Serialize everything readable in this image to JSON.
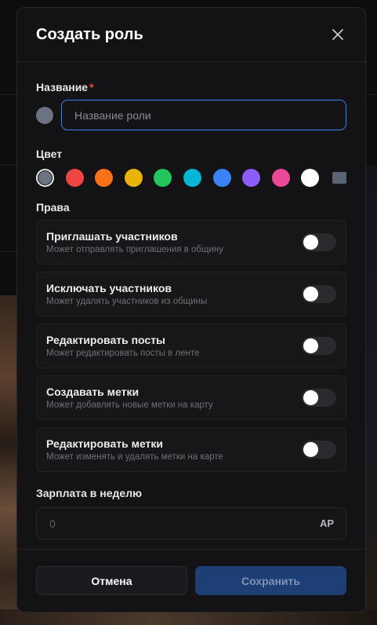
{
  "modal": {
    "title": "Создать роль",
    "close_icon": "close-icon"
  },
  "name_section": {
    "label": "Название",
    "required_mark": "*",
    "placeholder": "Название роли",
    "swatch_color": "#6b7280"
  },
  "color_section": {
    "label": "Цвет",
    "colors": [
      "#6b7280",
      "#ef4444",
      "#f97316",
      "#eab308",
      "#22c55e",
      "#06b6d4",
      "#3b82f6",
      "#8b5cf6",
      "#ec4899",
      "#ffffff"
    ],
    "selected_index": 0,
    "custom_color": "#5b6473"
  },
  "permissions": {
    "label": "Права",
    "items": [
      {
        "title": "Приглашать участников",
        "desc": "Может отправлять приглашения в общину",
        "enabled": false
      },
      {
        "title": "Исключать участников",
        "desc": "Может удалять участников из общины",
        "enabled": false
      },
      {
        "title": "Редактировать посты",
        "desc": "Может редактировать посты в ленте",
        "enabled": false
      },
      {
        "title": "Создавать метки",
        "desc": "Может добавлять новые метки на карту",
        "enabled": false
      },
      {
        "title": "Редактировать метки",
        "desc": "Может изменять и удалять метки на карте",
        "enabled": false
      }
    ]
  },
  "salary": {
    "label": "Зарплата в неделю",
    "value": "0",
    "unit": "AP"
  },
  "footer": {
    "cancel_label": "Отмена",
    "save_label": "Сохранить"
  }
}
